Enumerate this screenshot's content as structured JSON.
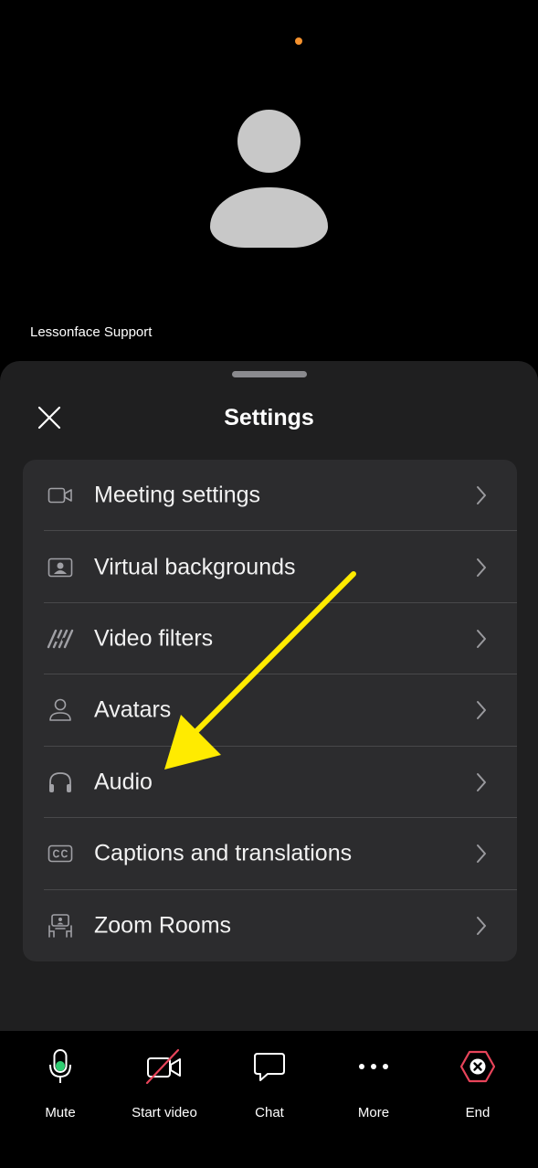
{
  "video": {
    "participant_name": "Lessonface Support"
  },
  "sheet": {
    "title": "Settings",
    "items": [
      {
        "label": "Meeting settings",
        "icon": "video-camera-icon"
      },
      {
        "label": "Virtual backgrounds",
        "icon": "portrait-icon"
      },
      {
        "label": "Video filters",
        "icon": "video-filters-icon"
      },
      {
        "label": "Avatars",
        "icon": "person-icon"
      },
      {
        "label": "Audio",
        "icon": "headphones-icon"
      },
      {
        "label": "Captions and translations",
        "icon": "cc-icon"
      },
      {
        "label": "Zoom Rooms",
        "icon": "zoom-rooms-icon"
      }
    ]
  },
  "toolbar": {
    "mute_label": "Mute",
    "video_label": "Start video",
    "chat_label": "Chat",
    "more_label": "More",
    "end_label": "End"
  },
  "colors": {
    "background": "#000000",
    "sheet": "#1f1f20",
    "card": "#2c2c2e",
    "accent_green": "#2ecc71",
    "end_red": "#e8445a",
    "video_off_red": "#e8445a",
    "annotation_yellow": "#ffeb00",
    "status_dot_orange": "#f5922e"
  }
}
